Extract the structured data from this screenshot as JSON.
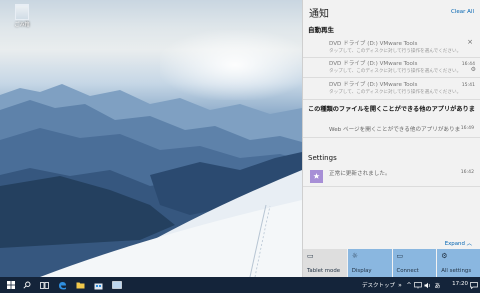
{
  "desktop": {
    "recycle_bin_label": "ごみ箱"
  },
  "action_center": {
    "title": "通知",
    "clear_all": "Clear All",
    "groups": {
      "autoplay": {
        "title": "自動再生",
        "close_glyph": "×",
        "notifications": [
          {
            "title": "DVD ドライブ (D:) VMware Tools",
            "subtitle": "タップして、このディスクに対して行う操作を選んでください。",
            "time": ""
          },
          {
            "title": "DVD ドライブ (D:) VMware Tools",
            "subtitle": "タップして、このディスクに対して行う操作を選んでください。",
            "time": "16:44"
          },
          {
            "title": "DVD ドライブ (D:) VMware Tools",
            "subtitle": "タップして、このディスクに対して行う操作を選んでください。",
            "time": "15:41"
          }
        ],
        "big_text": "この種類のファイルを開くことができる他のアプリがありま す。",
        "web_line": "Web ページを開くことができる他のアプリがありま",
        "web_time": "16:49"
      },
      "settings": {
        "title": "Settings",
        "message": "正常に更新されました。",
        "time": "16:42"
      }
    },
    "expand": "Expand",
    "quick_actions": [
      {
        "label": "Tablet mode",
        "icon": "tablet-mode-icon",
        "glyph": "▭",
        "active": false
      },
      {
        "label": "Display",
        "icon": "display-icon",
        "glyph": "☼",
        "active": true
      },
      {
        "label": "Connect",
        "icon": "connect-icon",
        "glyph": "▭",
        "active": true
      },
      {
        "label": "All settings",
        "icon": "gear-icon",
        "glyph": "⚙",
        "active": true
      }
    ]
  },
  "taskbar": {
    "desktop_label": "デスクトップ",
    "clock": "17:20"
  }
}
